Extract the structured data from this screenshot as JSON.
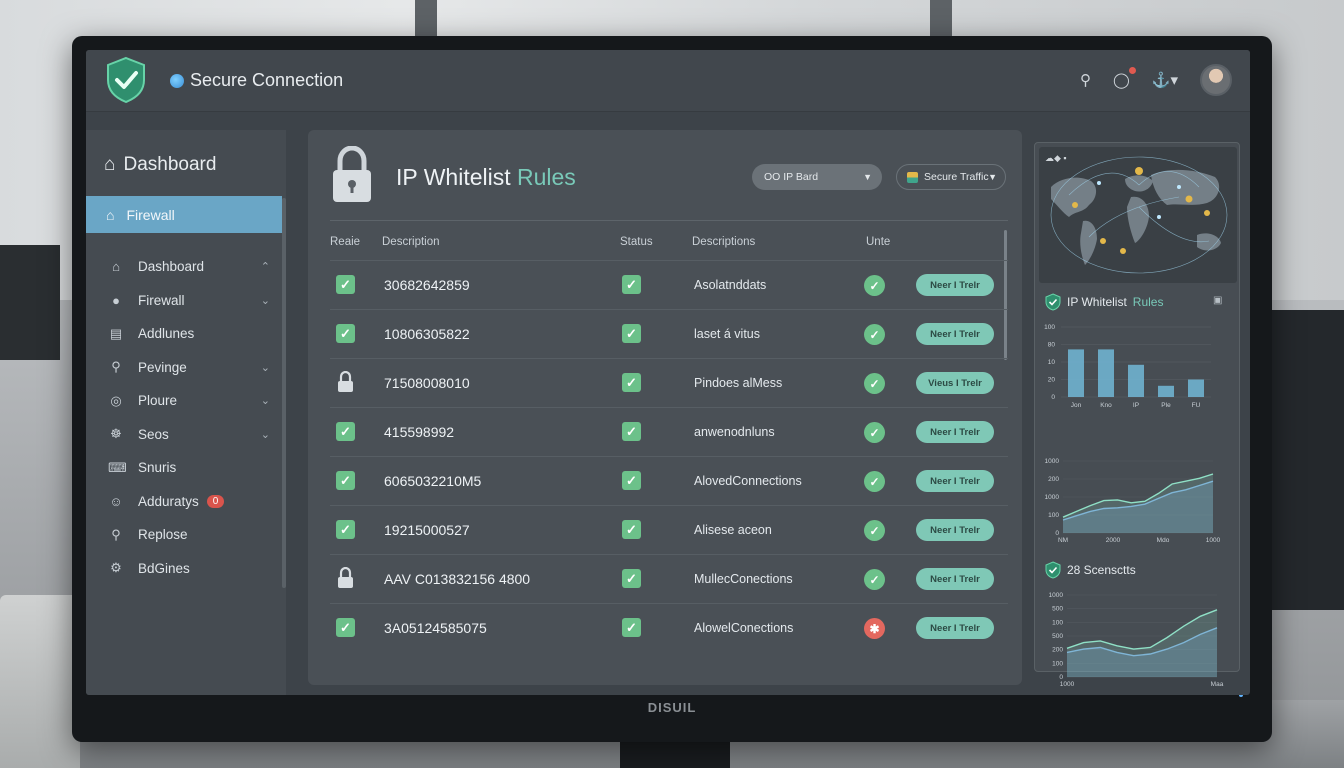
{
  "app": {
    "title": "Secure Connection",
    "brand": "DISUIL"
  },
  "topbar": {
    "icons": [
      "search-icon",
      "chat-icon",
      "bell-icon"
    ]
  },
  "sidebar": {
    "header": "Dashboard",
    "active": "Firewall",
    "items": [
      {
        "label": "Dashboard",
        "icon": "home-icon",
        "chevron": "up"
      },
      {
        "label": "Firewall",
        "icon": "user-icon",
        "chevron": "down"
      },
      {
        "label": "Addlunes",
        "icon": "list-icon",
        "chevron": ""
      },
      {
        "label": "Pevinge",
        "icon": "search-icon",
        "chevron": "down"
      },
      {
        "label": "Ploure",
        "icon": "target-icon",
        "chevron": "down"
      },
      {
        "label": "Seos",
        "icon": "globe-icon",
        "chevron": "down"
      },
      {
        "label": "Snuris",
        "icon": "keyboard-icon",
        "chevron": ""
      },
      {
        "label": "Adduratys",
        "icon": "face-icon",
        "chevron": "",
        "badge": "0"
      },
      {
        "label": "Replose",
        "icon": "search-icon",
        "chevron": ""
      },
      {
        "label": "BdGines",
        "icon": "gear-icon",
        "chevron": ""
      }
    ]
  },
  "main": {
    "title_plain": "IP Whitelist",
    "title_accent": "Rules",
    "dropdown1": "OO IP Bard",
    "dropdown2": "Secure Traffic",
    "columns": [
      "Reaie",
      "Description",
      "Status",
      "Descriptions",
      "Unte"
    ],
    "rows": [
      {
        "mark": "check",
        "ip": "30682642859",
        "desc": "Asolatnddats",
        "state": "ok",
        "action": "Neer I Trelr"
      },
      {
        "mark": "check",
        "ip": "10806305822",
        "desc": "laset á vitus",
        "state": "ok",
        "action": "Neer I Trelr"
      },
      {
        "mark": "lock",
        "ip": "71508008010",
        "desc": "Pindoes alMess",
        "state": "ok",
        "action": "Vieus I Trelr"
      },
      {
        "mark": "check",
        "ip": "415598992",
        "desc": "anwenodnluns",
        "state": "ok",
        "action": "Neer I Trelr"
      },
      {
        "mark": "check",
        "ip": "6065032210M5",
        "desc": "AlovedConnections",
        "state": "ok",
        "action": "Neer I Trelr"
      },
      {
        "mark": "check",
        "ip": "19215000527",
        "desc": "Alisese aceon",
        "state": "ok",
        "action": "Neer I Trelr"
      },
      {
        "mark": "lock",
        "ip": "AAV C013832156 4800",
        "desc": "MullecConections",
        "state": "ok",
        "action": "Neer I Trelr"
      },
      {
        "mark": "check",
        "ip": "3A05124585075",
        "desc": "AlowelConections",
        "state": "error",
        "action": "Neer I Trelr"
      }
    ]
  },
  "right_panel": {
    "bar_title_plain": "IP Whitelist",
    "bar_title_accent": "Rules",
    "sec3_title": "28 Scensctts"
  },
  "chart_data": [
    {
      "type": "bar",
      "categories": [
        "Jon",
        "Kno",
        "IP",
        "Ple",
        "FU"
      ],
      "values": [
        68,
        68,
        46,
        16,
        25
      ],
      "ylim": [
        0,
        100
      ],
      "ytick_labels": [
        "100",
        "80",
        "10",
        "20",
        "0"
      ]
    },
    {
      "type": "area",
      "x_labels": [
        "NM",
        "2000",
        "Mdo",
        "1000"
      ],
      "ytick_labels": [
        "1000",
        "200",
        "1000",
        "100",
        "0"
      ],
      "series": [
        {
          "values": [
            22,
            30,
            38,
            45,
            46,
            42,
            44,
            55,
            68,
            72,
            76,
            82
          ]
        },
        {
          "values": [
            18,
            24,
            30,
            34,
            35,
            37,
            40,
            48,
            56,
            60,
            66,
            72
          ]
        }
      ]
    },
    {
      "type": "area",
      "x_labels": [
        "1000",
        "Maa"
      ],
      "ytick_labels": [
        "1000",
        "500",
        "100",
        "500",
        "200",
        "100",
        "0"
      ],
      "series": [
        {
          "values": [
            35,
            42,
            44,
            38,
            34,
            36,
            48,
            62,
            74,
            82
          ]
        },
        {
          "values": [
            30,
            34,
            36,
            30,
            26,
            28,
            34,
            42,
            52,
            60
          ]
        }
      ]
    }
  ],
  "colors": {
    "accent": "#79c9b8",
    "ok": "#6cc18a",
    "error": "#e3685f",
    "sidebar_active": "#6aa6c6"
  }
}
